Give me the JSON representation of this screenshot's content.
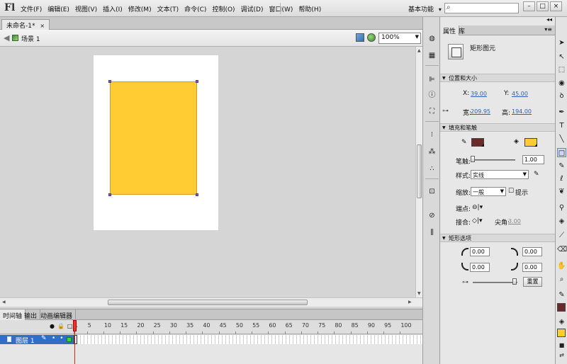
{
  "app": {
    "logo": "Fl",
    "menu": [
      "文件(F)",
      "编辑(E)",
      "视图(V)",
      "插入(I)",
      "修改(M)",
      "文本(T)",
      "命令(C)",
      "控制(O)",
      "调试(D)",
      "窗口(W)",
      "帮助(H)"
    ],
    "workspace": "基本功能",
    "workspace_arrow": "▾",
    "search_icon": "search-icon",
    "window_buttons": [
      "–",
      "□",
      "×"
    ]
  },
  "document": {
    "tab_label": "未命名-1*",
    "tab_close": "×",
    "scene": "场景 1",
    "zoom": "100%"
  },
  "stage": {
    "background": "#ffffff",
    "rectangle_fill": "#ffcc33",
    "rectangle_stroke": "#d49a2a"
  },
  "timeline": {
    "tabs": [
      "时间轴",
      "输出",
      "动画编辑器"
    ],
    "header_icons": [
      "eye-icon",
      "lock-icon",
      "outline-icon"
    ],
    "ruler": [
      "1",
      "5",
      "10",
      "15",
      "20",
      "25",
      "30",
      "35",
      "40",
      "45",
      "50",
      "55",
      "60",
      "65",
      "70",
      "75",
      "80",
      "85",
      "90",
      "95",
      "100"
    ],
    "layer": {
      "name": "图层 1",
      "color": "#43d04a"
    }
  },
  "properties": {
    "tabs": [
      "属性",
      "库"
    ],
    "object_type": "矩形图元",
    "sections": {
      "position": "位置和大小",
      "fill_stroke": "填充和笔触",
      "rect_options": "矩形选项"
    },
    "x_label": "X:",
    "x_value": "39.00",
    "y_label": "Y:",
    "y_value": "45.00",
    "width_label": "宽:",
    "width_value": "209.95",
    "height_label": "高:",
    "height_value": "194.00",
    "stroke_color": "#6a2a2a",
    "fill_color": "#ffcc33",
    "stroke_label": "笔触:",
    "stroke_value": "1.00",
    "style_label": "样式:",
    "style_value": "实线",
    "scale_label": "缩放:",
    "scale_value": "一般",
    "hint_label": "提示",
    "cap_label": "端点:",
    "join_label": "接合:",
    "miter_label": "尖角:",
    "miter_value": "3.00",
    "corners": [
      "0.00",
      "0.00",
      "0.00",
      "0.00"
    ],
    "reset_button": "重置"
  },
  "colors": {
    "tools_stroke": "#6a2a2a",
    "tools_fill": "#ffcc33"
  }
}
